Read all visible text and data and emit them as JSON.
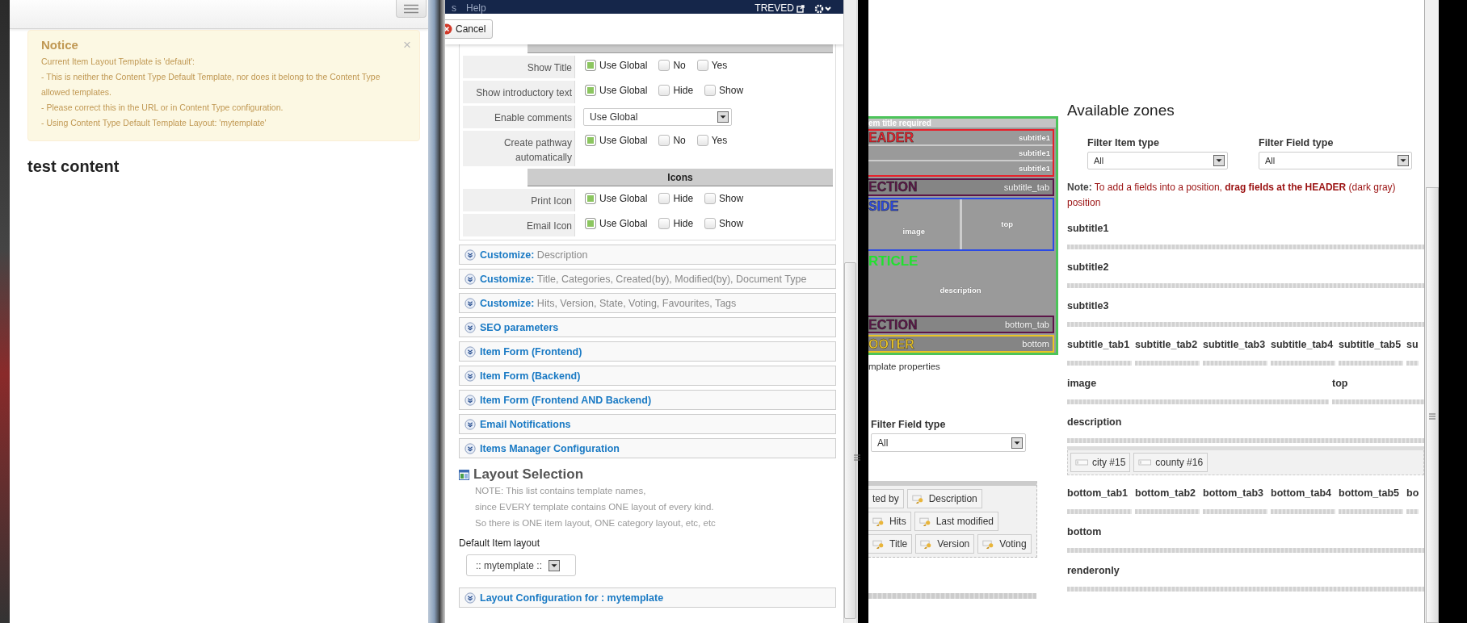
{
  "left_window": {
    "notice": {
      "title": "Notice",
      "close": "×",
      "lines": [
        "Current Item Layout Template is 'default':",
        "- This is neither the Content Type Default Template, nor does it belong to the Content Type allowed templates.",
        "- Please correct this in the URL or in Content Type configuration.",
        "- Using Content Type Default Template Layout: 'mytemplate'"
      ]
    },
    "heading": "test content"
  },
  "middle_window": {
    "topbar": {
      "menu": [
        "s",
        "Help"
      ],
      "user": "TREVED"
    },
    "cancel_button": "Cancel",
    "option_rows": [
      {
        "kind": "radio",
        "label": "Show Title",
        "options": [
          {
            "label": "Use Global",
            "selected": true
          },
          {
            "label": "No",
            "selected": false
          },
          {
            "label": "Yes",
            "selected": false
          }
        ]
      },
      {
        "kind": "radio",
        "label": "Show introductory text",
        "options": [
          {
            "label": "Use Global",
            "selected": true
          },
          {
            "label": "Hide",
            "selected": false
          },
          {
            "label": "Show",
            "selected": false
          }
        ]
      },
      {
        "kind": "select",
        "label": "Enable comments",
        "value": "Use Global"
      },
      {
        "kind": "radio",
        "label": "Create pathway automatically",
        "options": [
          {
            "label": "Use Global",
            "selected": true
          },
          {
            "label": "No",
            "selected": false
          },
          {
            "label": "Yes",
            "selected": false
          }
        ]
      },
      {
        "kind": "section",
        "label": "Icons"
      },
      {
        "kind": "radio",
        "label": "Print Icon",
        "options": [
          {
            "label": "Use Global",
            "selected": true
          },
          {
            "label": "Hide",
            "selected": false
          },
          {
            "label": "Show",
            "selected": false
          }
        ]
      },
      {
        "kind": "radio",
        "label": "Email Icon",
        "options": [
          {
            "label": "Use Global",
            "selected": true
          },
          {
            "label": "Hide",
            "selected": false
          },
          {
            "label": "Show",
            "selected": false
          }
        ]
      }
    ],
    "panels": [
      {
        "title": "Customize:",
        "detail": "Description"
      },
      {
        "title": "Customize:",
        "detail": "Title, Categories, Created(by), Modified(by), Document Type"
      },
      {
        "title": "Customize:",
        "detail": "Hits, Version, State, Voting, Favourites, Tags"
      },
      {
        "title": "SEO parameters"
      },
      {
        "title": "Item Form (Frontend)"
      },
      {
        "title": "Item Form (Backend)"
      },
      {
        "title": "Item Form (Frontend AND Backend)"
      },
      {
        "title": "Email Notifications"
      },
      {
        "title": "Items Manager Configuration"
      }
    ],
    "layout_selection": {
      "title": "Layout Selection",
      "note_lines": [
        "NOTE: This list contains template names,",
        "since EVERY template contains ONE layout of every kind.",
        "So there is ONE item layout, ONE category layout, etc, etc"
      ],
      "default_label": "Default Item layout",
      "default_value": ":: mytemplate ::"
    },
    "last_panel": {
      "title": "Layout Configuration for : mytemplate"
    }
  },
  "right_window": {
    "template_preview": {
      "title": "em title required",
      "bands": [
        {
          "kind": "rows",
          "name": "EADER",
          "color": "#e8202a",
          "slots": [
            "subtitle1",
            "subtitle1",
            "subtitle1"
          ]
        },
        {
          "kind": "plain",
          "name": "ECTION",
          "color": "#5c1548",
          "slots": [
            "subtitle_tab"
          ]
        },
        {
          "kind": "split",
          "name": "SIDE",
          "color": "#2a4ae6",
          "slots": [
            "image",
            "top"
          ]
        },
        {
          "kind": "center",
          "name": "RTICLE",
          "color": "#22e030",
          "slots": [
            "description"
          ]
        },
        {
          "kind": "plain",
          "name": "ECTION",
          "color": "#5c1548",
          "slots": [
            "bottom_tab"
          ]
        },
        {
          "kind": "plain",
          "name": "OOTER",
          "color": "#eac426",
          "slots": [
            "bottom"
          ]
        }
      ]
    },
    "template_properties": "mplate properties",
    "field_filter": {
      "label": "Filter Field type",
      "value": "All"
    },
    "field_chip_rows": [
      [
        {
          "label": "ted by",
          "icon": false
        },
        {
          "label": "Description",
          "icon": true
        }
      ],
      [
        {
          "label": "Hits",
          "icon": true
        },
        {
          "label": "Last modified",
          "icon": true
        }
      ],
      [
        {
          "label": "Title",
          "icon": true
        },
        {
          "label": "Version",
          "icon": true
        },
        {
          "label": "Voting",
          "icon": true
        }
      ]
    ],
    "zones_heading": "Available zones",
    "filters": [
      {
        "label": "Filter Item type",
        "value": "All"
      },
      {
        "label": "Filter Field type",
        "value": "All"
      }
    ],
    "note_lines": [
      "**Note:** To add a fields into a position, **drag fields at the HEADER** (dark gray)",
      "position"
    ],
    "zones": [
      {
        "kind": "single",
        "labels": [
          "subtitle1"
        ]
      },
      {
        "kind": "single",
        "labels": [
          "subtitle2"
        ]
      },
      {
        "kind": "single",
        "labels": [
          "subtitle3"
        ]
      },
      {
        "kind": "columns",
        "labels": [
          "subtitle_tab1",
          "subtitle_tab2",
          "subtitle_tab3",
          "subtitle_tab4",
          "subtitle_tab5",
          "su"
        ]
      },
      {
        "kind": "split",
        "labels": [
          "image",
          "top"
        ]
      },
      {
        "kind": "single",
        "labels": [
          "description"
        ],
        "fields": [
          "city #15",
          "county #16"
        ]
      },
      {
        "kind": "columns",
        "labels": [
          "bottom_tab1",
          "bottom_tab2",
          "bottom_tab3",
          "bottom_tab4",
          "bottom_tab5",
          "bo"
        ]
      },
      {
        "kind": "single",
        "labels": [
          "bottom"
        ]
      },
      {
        "kind": "single",
        "labels": [
          "renderonly"
        ]
      }
    ]
  }
}
